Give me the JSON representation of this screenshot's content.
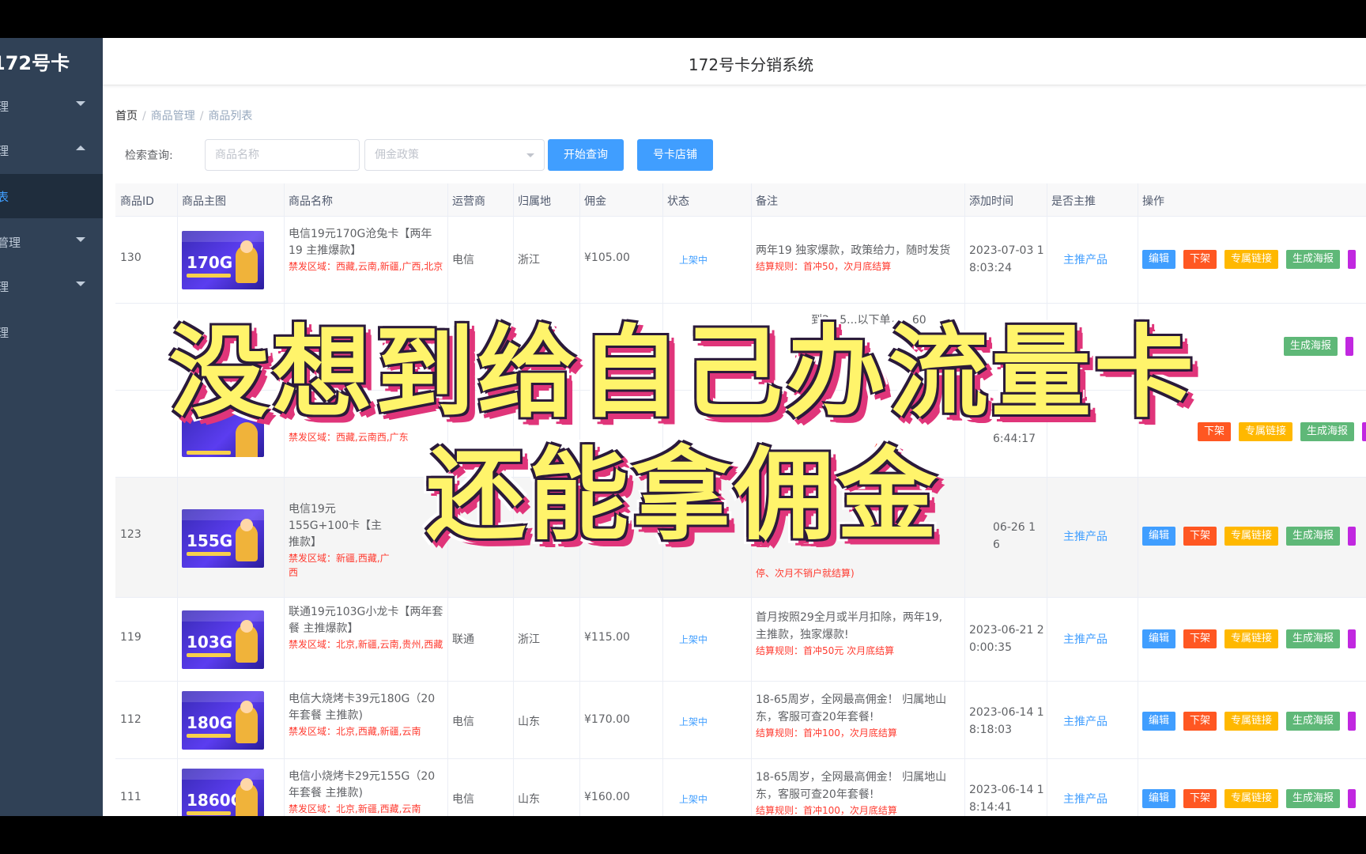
{
  "app": {
    "logo": "172号卡",
    "window_title": "172号卡分销系统"
  },
  "sidebar": {
    "items": [
      {
        "label": "理",
        "expanded": false
      },
      {
        "label": "理",
        "expanded": true
      },
      {
        "label": "表",
        "active": true
      },
      {
        "label": "管理",
        "expanded": false
      },
      {
        "label": "理",
        "expanded": false
      },
      {
        "label": "理"
      }
    ]
  },
  "breadcrumb": [
    "首页",
    "商品管理",
    "商品列表"
  ],
  "search": {
    "label": "检索查询:",
    "name_placeholder": "商品名称",
    "policy_placeholder": "佣金政策",
    "query_button": "开始查询",
    "shop_button": "号卡店铺"
  },
  "table": {
    "headers": [
      "商品ID",
      "商品主图",
      "商品名称",
      "运营商",
      "归属地",
      "佣金",
      "状态",
      "备注",
      "添加时间",
      "是否主推",
      "操作"
    ],
    "action_labels": {
      "edit": "编辑",
      "off": "下架",
      "link": "专属链接",
      "poster": "生成海报"
    },
    "rows": [
      {
        "id": "130",
        "thumb_label": "170G",
        "name": "电信19元170G沧兔卡【两年19 主推爆款】",
        "ban": "禁发区域：西藏,云南,新疆,广西,北京",
        "carrier": "电信",
        "region": "浙江",
        "commission": "¥105.00",
        "status": "上架中",
        "remark": "两年19 独家爆款，政策给力，随时发货",
        "settle": "结算规则：首冲50，次月底结算",
        "added": "2023-07-03 18:03:24",
        "pushed": "主推产品"
      },
      {
        "id": "",
        "thumb_label": "",
        "name": "",
        "ban": "",
        "carrier": "",
        "region": "",
        "commission": "",
        "status": "",
        "remark": "到2...5...以下单，...60",
        "settle": "",
        "added": "",
        "pushed": ""
      },
      {
        "id": "",
        "thumb_label": "",
        "name": "",
        "ban": "禁发区域：西藏,云南西,广东",
        "carrier": "",
        "region": "",
        "commission": "",
        "status": "",
        "remark": "",
        "settle": "结算",
        "added": "6:44:17",
        "pushed": ""
      },
      {
        "id": "123",
        "thumb_label": "155G",
        "name": "电信19元155G+100卡【主推款】",
        "ban": "禁发区域：新疆,西藏,广西",
        "carrier": "",
        "region": "",
        "commission": "",
        "status": "",
        "remark": "",
        "settle": "停、次月不销户就结算)",
        "added": "06-26 16",
        "pushed": "主推产品"
      },
      {
        "id": "119",
        "thumb_label": "103G",
        "name": "联通19元103G小龙卡【两年套餐 主推爆款】",
        "ban": "禁发区域：北京,新疆,云南,贵州,西藏",
        "carrier": "联通",
        "region": "浙江",
        "commission": "¥115.00",
        "status": "上架中",
        "remark": "首月按照29全月或半月扣除，两年19,主推款，独家爆款!",
        "settle": "结算规则：首冲50元 次月底结算",
        "added": "2023-06-21 20:00:35",
        "pushed": "主推产品"
      },
      {
        "id": "112",
        "thumb_label": "180G",
        "name": "电信大烧烤卡39元180G（20年套餐 主推款)",
        "ban": "禁发区域：北京,西藏,新疆,云南",
        "carrier": "电信",
        "region": "山东",
        "commission": "¥170.00",
        "status": "上架中",
        "remark": "18-65周岁，全网最高佣金！ 归属地山东，客服可查20年套餐!",
        "settle": "结算规则：首冲100，次月底结算",
        "added": "2023-06-14 18:18:03",
        "pushed": "主推产品"
      },
      {
        "id": "111",
        "thumb_label": "1860G",
        "name": "电信小烧烤卡29元155G（20年套餐 主推款)",
        "ban": "禁发区域：北京,新疆,西藏,云南",
        "carrier": "电信",
        "region": "山东",
        "commission": "¥160.00",
        "status": "上架中",
        "remark": "18-65周岁，全网最高佣金！ 归属地山东，客服可查20年套餐!",
        "settle": "结算规则：首冲100，次月底结算",
        "added": "2023-06-14 18:14:41",
        "pushed": "主推产品"
      }
    ]
  },
  "overlay": {
    "line1": "没想到给自己办流量卡",
    "line2": "还能拿佣金"
  },
  "colors": {
    "sidebar_bg": "#304156",
    "primary": "#409eff",
    "btn_red": "#ff5722",
    "btn_yellow": "#ffb800",
    "btn_green": "#5fb878",
    "caption_fill": "#fff46b",
    "caption_shadow": "#e0357a"
  }
}
